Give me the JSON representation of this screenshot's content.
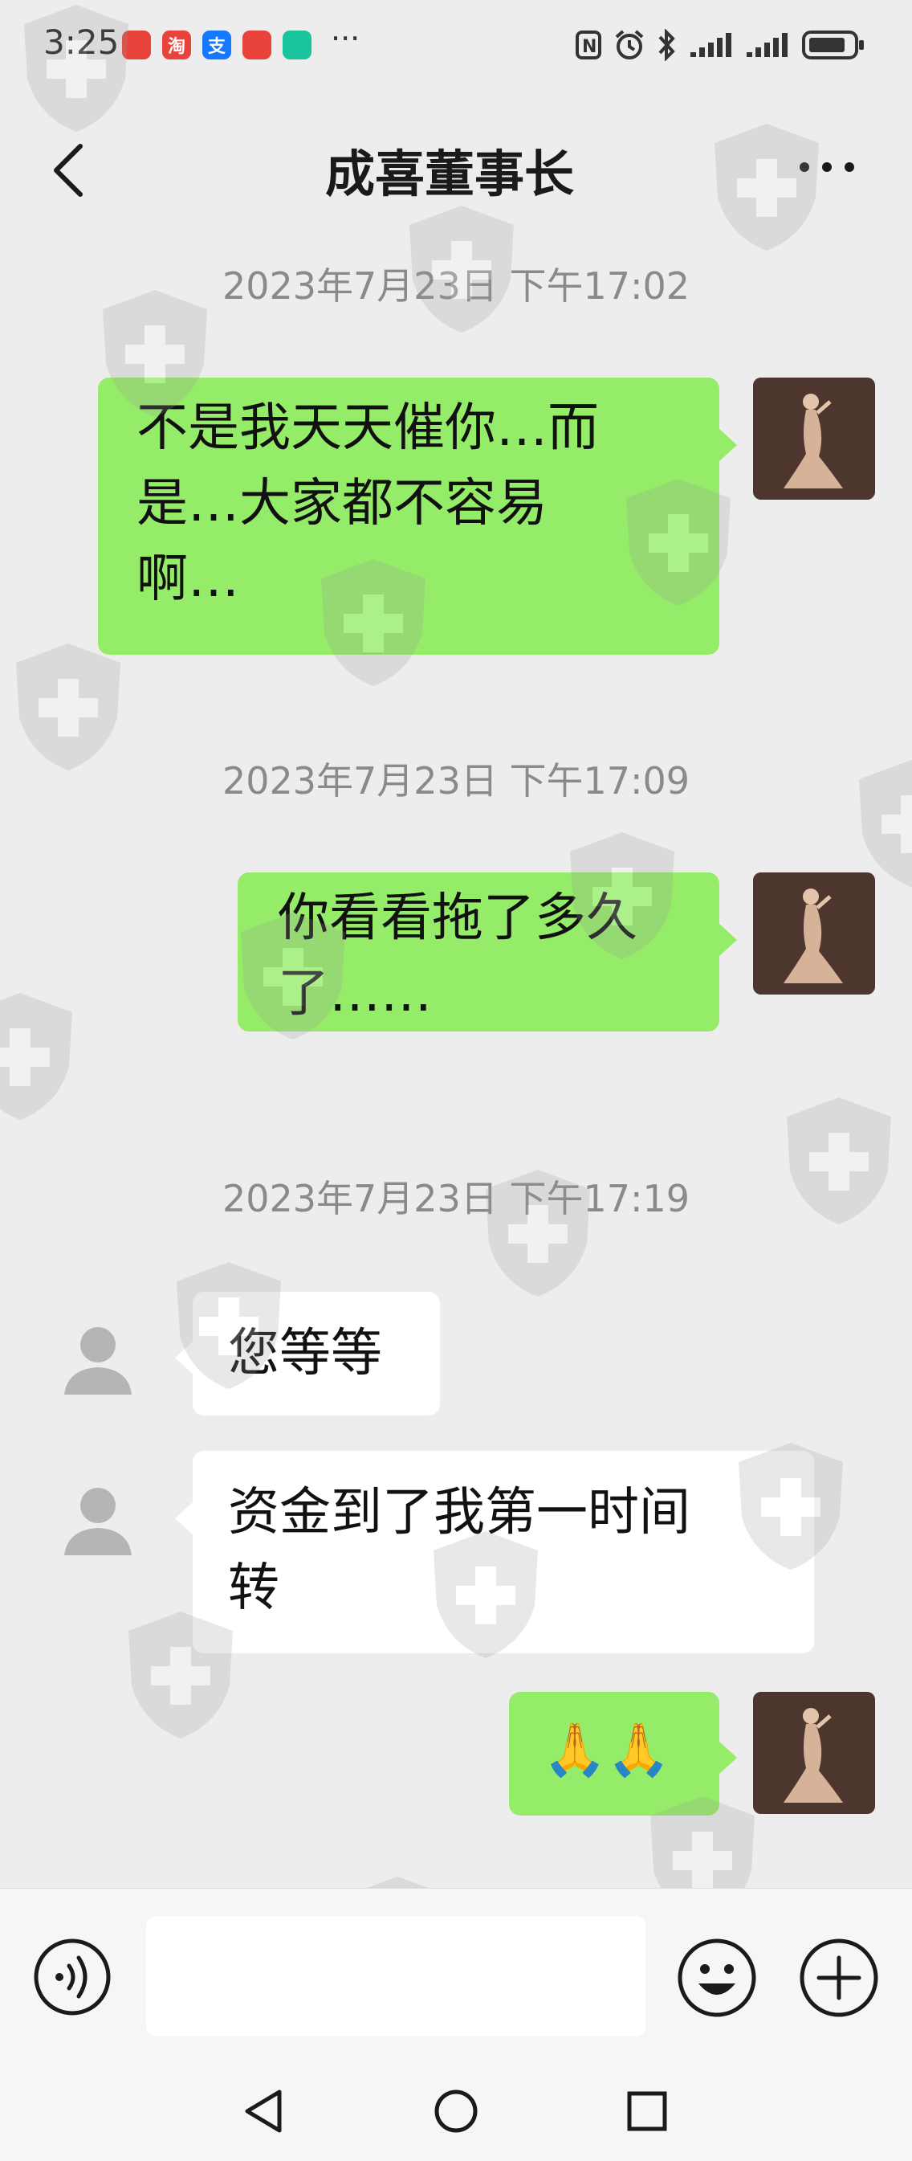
{
  "status_bar": {
    "time": "3:25",
    "app_icons": [
      {
        "name": "huawei-app-icon",
        "glyph": "",
        "color": "#e8423a"
      },
      {
        "name": "taobao-app-icon",
        "glyph": "淘",
        "color": "#e8423a"
      },
      {
        "name": "alipay-app-icon",
        "glyph": "支",
        "color": "#1677ff"
      },
      {
        "name": "red-app-icon",
        "glyph": "",
        "color": "#e8423a"
      },
      {
        "name": "shield-app-icon",
        "glyph": "",
        "color": "#19c39b"
      }
    ],
    "more": "···",
    "right_icons": [
      "nfc-icon",
      "alarm-icon",
      "bluetooth-icon",
      "signal-icon",
      "signal-icon",
      "battery-icon"
    ]
  },
  "header": {
    "title": "成喜董事长",
    "back_icon": "chevron-left-icon",
    "more_icon": "more-dots-icon"
  },
  "messages": [
    {
      "type": "timestamp",
      "text": "2023年7月23日 下午17:02"
    },
    {
      "type": "me",
      "lines": [
        "不是我天天催你…而",
        "是…大家都不容易",
        "啊…"
      ]
    },
    {
      "type": "timestamp",
      "text": "2023年7月23日 下午17:09"
    },
    {
      "type": "me",
      "lines": [
        "你看看拖了多久",
        "了……"
      ]
    },
    {
      "type": "timestamp",
      "text": "2023年7月23日 下午17:19"
    },
    {
      "type": "other",
      "lines": [
        "您等等"
      ]
    },
    {
      "type": "other",
      "lines": [
        "资金到了我第一时间",
        "转"
      ]
    },
    {
      "type": "me",
      "lines": [
        "🙏🙏"
      ]
    }
  ],
  "input_bar": {
    "voice_icon": "voice-icon",
    "input_value": "",
    "emoji_icon": "emoji-icon",
    "plus_icon": "plus-icon"
  },
  "nav_bar": {
    "icons": [
      "back-triangle-icon",
      "home-circle-icon",
      "recents-square-icon"
    ]
  },
  "colors": {
    "my_bubble": "#95ec69",
    "other_bubble": "#ffffff",
    "background": "#ededed"
  }
}
